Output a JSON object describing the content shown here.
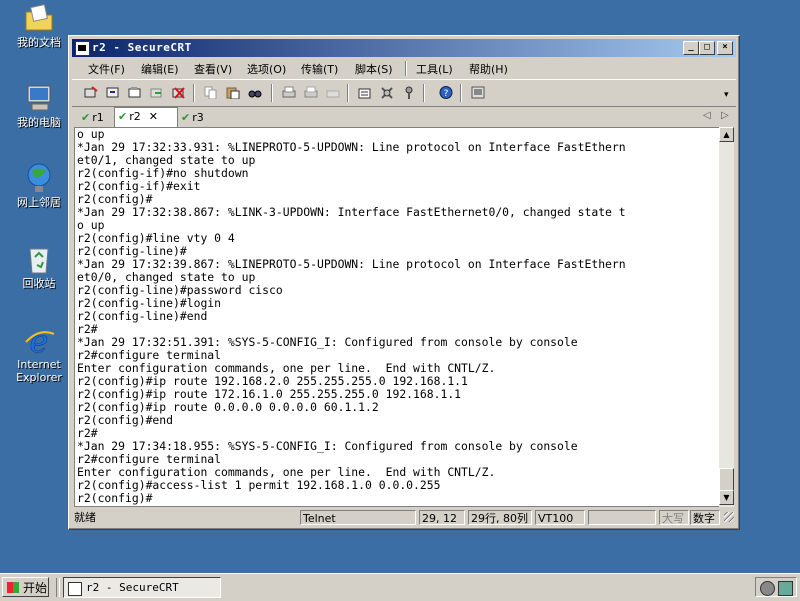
{
  "desktop": {
    "icons": [
      {
        "label": "我的文档",
        "icon": "folder-documents-icon"
      },
      {
        "label": "我的电脑",
        "icon": "computer-icon"
      },
      {
        "label": "网上邻居",
        "icon": "network-icon"
      },
      {
        "label": "回收站",
        "icon": "recycle-bin-icon"
      },
      {
        "label": "Internet Explorer",
        "icon": "internet-explorer-icon"
      }
    ]
  },
  "window": {
    "title": "r2 - SecureCRT",
    "buttons": {
      "minimize": "_",
      "maximize": "□",
      "close": "×"
    }
  },
  "menu": [
    "文件(F)",
    "编辑(E)",
    "查看(V)",
    "选项(O)",
    "传输(T)",
    "脚本(S)",
    "工具(L)",
    "帮助(H)"
  ],
  "toolbar_icons": [
    "connect-icon",
    "quick-connect-icon",
    "connect-tab-icon",
    "reconnect-icon",
    "disconnect-icon",
    "copy-icon",
    "paste-icon",
    "find-icon",
    "print-icon",
    "print-selection-icon",
    "print-setup-icon",
    "session-options-icon",
    "global-options-icon",
    "keymap-icon",
    "help-icon",
    "sftp-icon"
  ],
  "tabs": [
    {
      "label": "r1",
      "active": false
    },
    {
      "label": "r2",
      "active": true,
      "close": "✕"
    },
    {
      "label": "r3",
      "active": false
    }
  ],
  "tab_nav": {
    "left": "◁",
    "right": "▷"
  },
  "terminal": {
    "lines": [
      "o up",
      "*Jan 29 17:32:33.931: %LINEPROTO-5-UPDOWN: Line protocol on Interface FastEthern",
      "et0/1, changed state to up",
      "r2(config-if)#no shutdown",
      "r2(config-if)#exit",
      "r2(config)#",
      "*Jan 29 17:32:38.867: %LINK-3-UPDOWN: Interface FastEthernet0/0, changed state t",
      "o up",
      "r2(config)#line vty 0 4",
      "r2(config-line)#",
      "*Jan 29 17:32:39.867: %LINEPROTO-5-UPDOWN: Line protocol on Interface FastEthern",
      "et0/0, changed state to up",
      "r2(config-line)#password cisco",
      "r2(config-line)#login",
      "r2(config-line)#end",
      "r2#",
      "*Jan 29 17:32:51.391: %SYS-5-CONFIG_I: Configured from console by console",
      "r2#configure terminal",
      "Enter configuration commands, one per line.  End with CNTL/Z.",
      "r2(config)#ip route 192.168.2.0 255.255.255.0 192.168.1.1",
      "r2(config)#ip route 172.16.1.0 255.255.255.0 192.168.1.1",
      "r2(config)#ip route 0.0.0.0 0.0.0.0 60.1.1.2",
      "r2(config)#end",
      "r2#",
      "*Jan 29 17:34:18.955: %SYS-5-CONFIG_I: Configured from console by console",
      "r2#configure terminal",
      "Enter configuration commands, one per line.  End with CNTL/Z.",
      "r2(config)#access-list 1 permit 192.168.1.0 0.0.0.255",
      "r2(config)#"
    ]
  },
  "statusbar": {
    "ready": "就绪",
    "protocol": "Telnet",
    "cursor": "29, 12",
    "size": "29行, 80列",
    "emulation": "VT100",
    "blank": "",
    "caps": "大写",
    "num": "数字"
  },
  "taskbar": {
    "start": "开始",
    "task": "r2 - SecureCRT",
    "tray_icons": [
      "speaker-icon",
      "network-tray-icon"
    ]
  }
}
